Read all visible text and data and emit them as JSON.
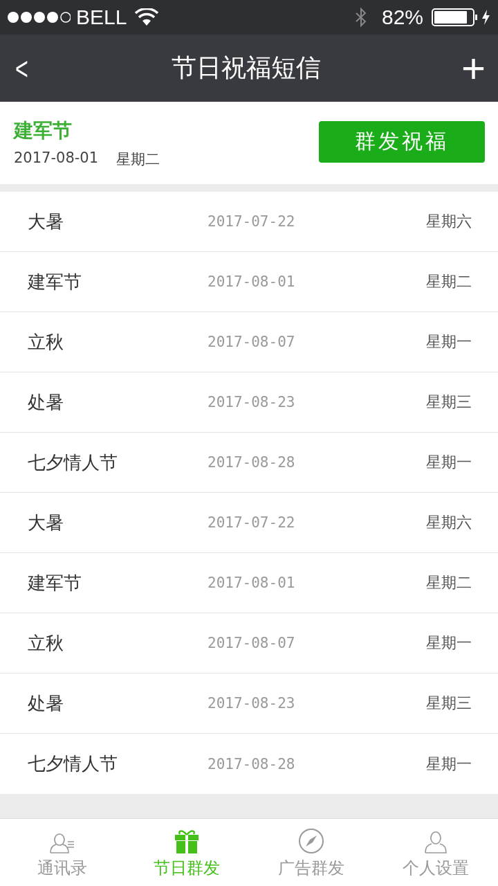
{
  "status_bar": {
    "carrier": "BELL",
    "battery": "82%"
  },
  "nav": {
    "back": "<",
    "title": "节日祝福短信",
    "add": "+"
  },
  "current": {
    "name": "建军节",
    "date": "2017-08-01",
    "weekday": "星期二",
    "button": "群发祝福"
  },
  "holidays": [
    {
      "name": "大暑",
      "date": "2017-07-22",
      "weekday": "星期六"
    },
    {
      "name": "建军节",
      "date": "2017-08-01",
      "weekday": "星期二"
    },
    {
      "name": "立秋",
      "date": "2017-08-07",
      "weekday": "星期一"
    },
    {
      "name": "处暑",
      "date": "2017-08-23",
      "weekday": "星期三"
    },
    {
      "name": "七夕情人节",
      "date": "2017-08-28",
      "weekday": "星期一"
    },
    {
      "name": "大暑",
      "date": "2017-07-22",
      "weekday": "星期六"
    },
    {
      "name": "建军节",
      "date": "2017-08-01",
      "weekday": "星期二"
    },
    {
      "name": "立秋",
      "date": "2017-08-07",
      "weekday": "星期一"
    },
    {
      "name": "处暑",
      "date": "2017-08-23",
      "weekday": "星期三"
    },
    {
      "name": "七夕情人节",
      "date": "2017-08-28",
      "weekday": "星期一"
    }
  ],
  "tabs": [
    {
      "label": "通讯录",
      "kind": "contacts",
      "selected": false
    },
    {
      "label": "节日群发",
      "kind": "gift",
      "selected": true
    },
    {
      "label": "广告群发",
      "kind": "compass",
      "selected": false
    },
    {
      "label": "个人设置",
      "kind": "person",
      "selected": false
    }
  ]
}
